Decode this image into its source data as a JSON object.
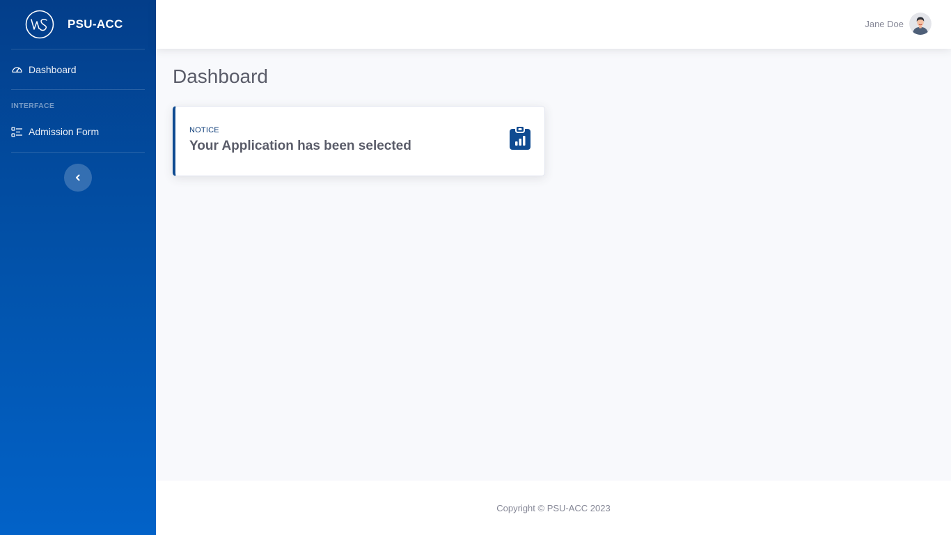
{
  "brand": {
    "name": "PSU-ACC",
    "logo_icon": "ws-logo-icon"
  },
  "sidebar": {
    "items": [
      {
        "label": "Dashboard",
        "icon": "gauge-icon"
      },
      {
        "label": "Admission Form",
        "icon": "checklist-icon"
      }
    ],
    "section_heading": "INTERFACE",
    "toggle_icon": "chevron-left-icon"
  },
  "topbar": {
    "user_name": "Jane Doe",
    "avatar_icon": "user-avatar-icon"
  },
  "main": {
    "title": "Dashboard",
    "notice_card": {
      "kicker": "NOTICE",
      "message": "Your Application has been selected",
      "icon": "clipboard-chart-icon",
      "accent": "#0f4b91"
    }
  },
  "footer": {
    "copyright": "Copyright © PSU-ACC 2023"
  },
  "colors": {
    "sidebar_top": "#033e8a",
    "sidebar_bottom": "#0262c8",
    "page_bg": "#f8f9fc",
    "text_gray": "#5a5c69"
  }
}
